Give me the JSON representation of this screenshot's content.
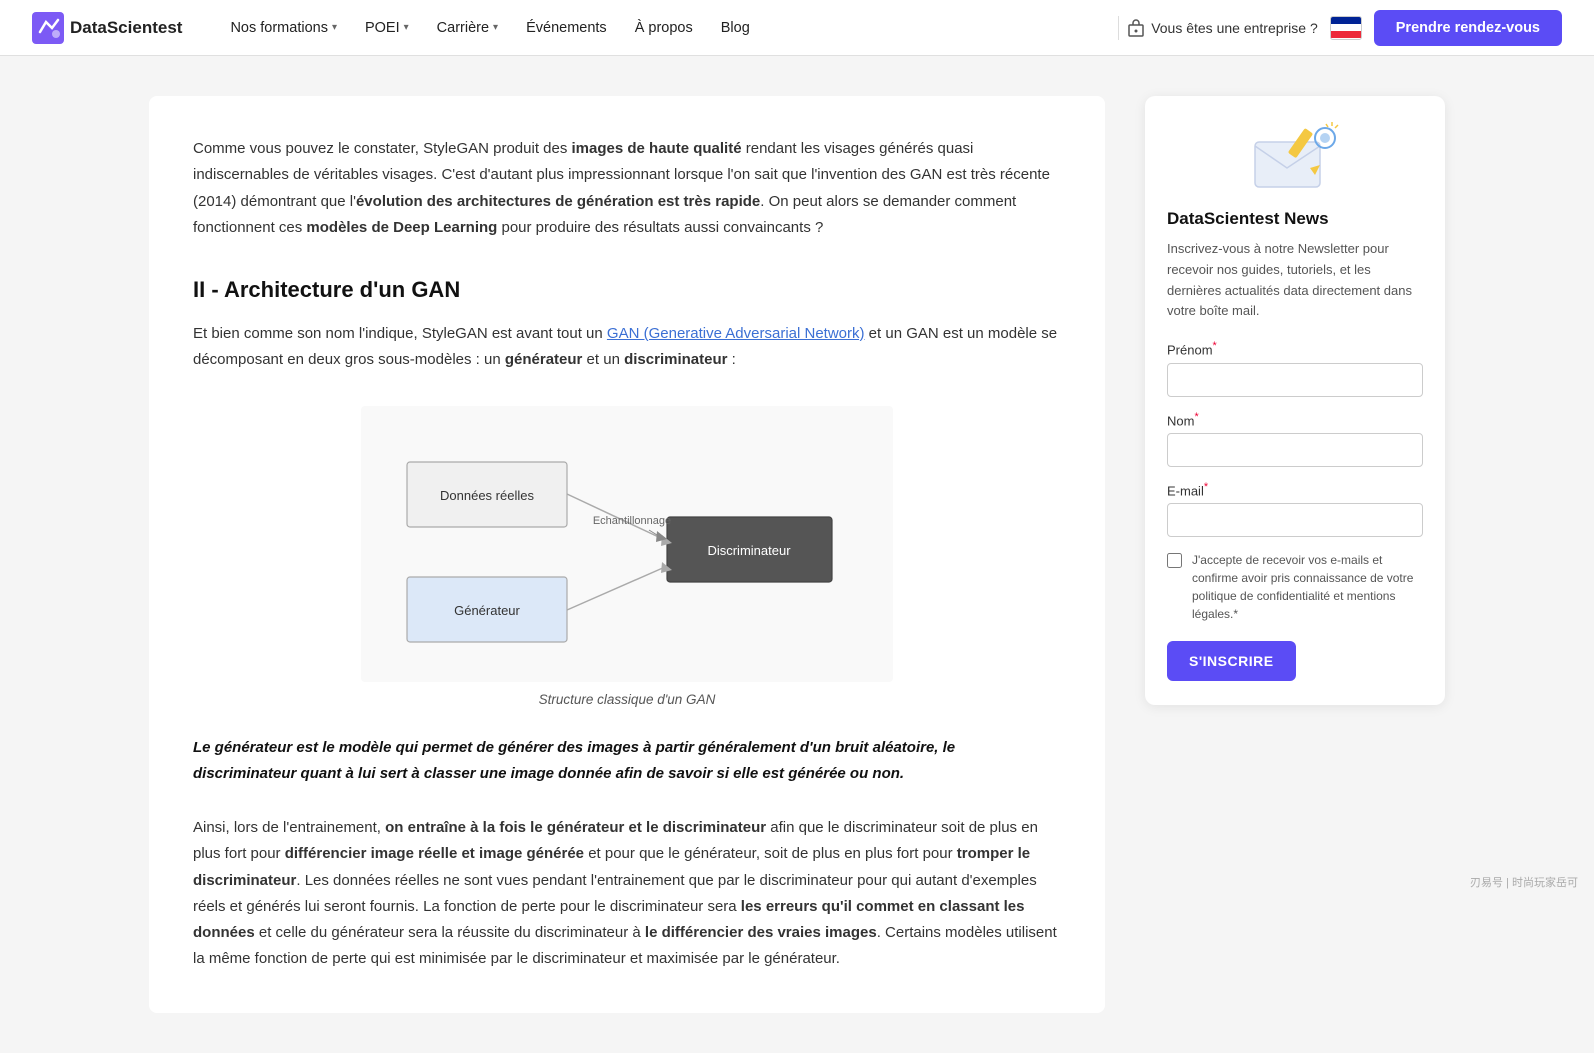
{
  "navbar": {
    "logo_text": "DataScientest",
    "nav_items": [
      {
        "label": "Nos formations",
        "has_dropdown": true
      },
      {
        "label": "POEI",
        "has_dropdown": true
      },
      {
        "label": "Carrière",
        "has_dropdown": true
      },
      {
        "label": "Événements",
        "has_dropdown": false
      },
      {
        "label": "À propos",
        "has_dropdown": false
      },
      {
        "label": "Blog",
        "has_dropdown": false
      }
    ],
    "enterprise_label": "Vous êtes une entreprise ?",
    "cta_label": "Prendre rendez-vous"
  },
  "main": {
    "intro": {
      "text_before_bold1": "Comme vous pouvez le constater, StyleGAN produit des ",
      "bold1": "images de haute qualité",
      "text_after_bold1": " rendant les visages générés quasi indiscernables de véritables visages. C'est d'autant plus impressionnant lorsque l'on sait que l'invention des GAN est très récente (2014) démontrant que l'",
      "bold2": "évolution des architectures de génération est très rapide",
      "text_after_bold2": ". On peut alors se demander comment fonctionnent ces ",
      "bold3": "modèles de Deep Learning",
      "text_after_bold3": " pour produire des résultats aussi convaincants ?"
    },
    "section_heading": "II - Architecture d'un GAN",
    "section_intro": {
      "text_before_link": "Et bien comme son nom l'indique, StyleGAN est avant tout un ",
      "link_text": "GAN (Generative Adversarial Network)",
      "text_after_link": " et un GAN est un modèle se décomposant en deux gros sous-modèles : un ",
      "bold1": "générateur",
      "text_middle": " et un ",
      "bold2": "discriminateur",
      "text_end": " :"
    },
    "diagram": {
      "caption": "Structure classique d'un GAN",
      "node_donnees": "Données réelles",
      "node_echantillonnage": "Echantillonnage",
      "node_discriminateur": "Discriminateur",
      "node_generateur": "Générateur"
    },
    "blockquote": "Le générateur est le modèle qui permet de générer des images à partir généralement d'un bruit aléatoire, le discriminateur quant à lui sert à classer une image donnée afin de savoir si elle est générée ou non.",
    "bottom_para": {
      "text1": "Ainsi, lors de l'entrainement, ",
      "bold1": "on entraîne à la fois le générateur et le discriminateur",
      "text2": " afin que le discriminateur soit de plus en plus fort pour ",
      "bold2": "différencier image réelle et image générée",
      "text3": " et pour que le générateur, soit de plus en plus fort pour ",
      "bold3": "tromper le discriminateur",
      "text4": ". Les données réelles ne sont vues pendant l'entrainement que par le discriminateur pour qui autant d'exemples réels et générés lui seront fournis. La fonction de perte pour le discriminateur sera ",
      "bold4": "les erreurs qu'il commet en classant les données",
      "text5": " et celle du générateur sera la réussite du discriminateur à ",
      "bold5": "le différencier des vraies images",
      "text6": ". Certains modèles utilisent la même fonction de perte qui est minimisée par le discriminateur et maximisée par le générateur."
    }
  },
  "sidebar": {
    "newsletter": {
      "title": "DataScientest News",
      "description": "Inscrivez-vous à notre Newsletter pour recevoir nos guides, tutoriels, et les dernières actualités data directement dans votre boîte mail.",
      "prenom_label": "Prénom",
      "prenom_required": true,
      "nom_label": "Nom",
      "nom_required": true,
      "email_label": "E-mail",
      "email_required": true,
      "checkbox_label": "J'accepte de recevoir vos e-mails et confirme avoir pris connaissance de votre politique de confidentialité et mentions légales.*",
      "subscribe_button": "S'INSCRIRE"
    }
  },
  "watermark": "刃易号 | 时尚玩家岳可"
}
